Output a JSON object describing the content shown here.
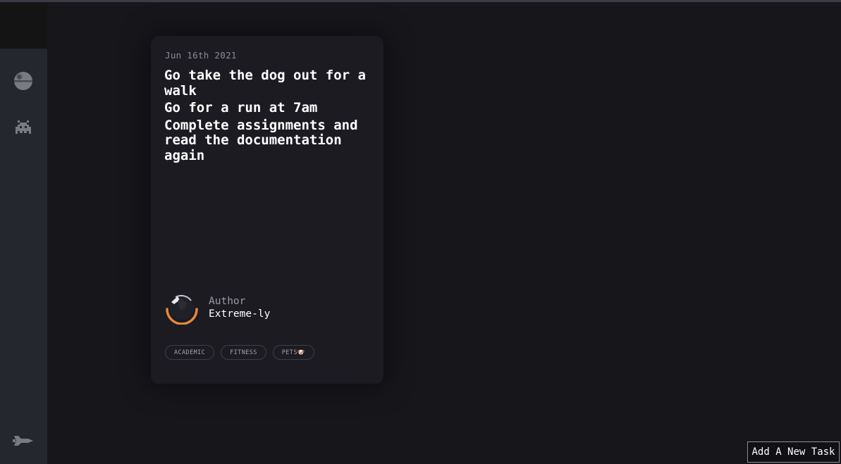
{
  "sidebar": {
    "items": [
      {
        "icon": "death-star-icon"
      },
      {
        "icon": "space-invader-icon"
      },
      {
        "icon": "spaceship-icon"
      }
    ]
  },
  "card": {
    "date": "Jun 16th 2021",
    "tasks": [
      "Go take the dog out for a walk",
      "Go for a run at 7am",
      "Complete assignments and read the documentation again"
    ],
    "author_label": "Author",
    "author_name": "Extreme-ly",
    "tags": [
      "ACADEMIC",
      "FITNESS",
      "PETS🐶"
    ]
  },
  "add_task_label": "Add A New Task",
  "colors": {
    "background": "#17161b",
    "sidebar": "#25272f",
    "card": "#1c1b22",
    "avatar_ring": "#e8893a"
  }
}
